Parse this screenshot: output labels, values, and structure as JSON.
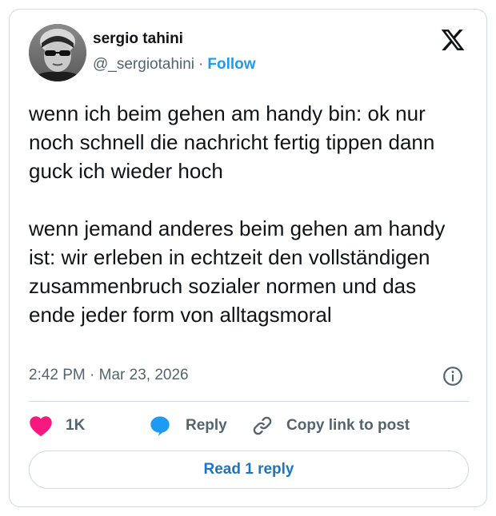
{
  "author": {
    "name": "sergio tahini",
    "handle": "@_sergiotahini",
    "separator": "·",
    "follow_label": "Follow"
  },
  "tweet": {
    "text": "wenn ich beim gehen am handy bin: ok nur noch schnell die nachricht fertig tippen dann guck ich wieder hoch\n\nwenn jemand anderes beim gehen am handy ist: wir erleben in echtzeit den vollständigen zusammenbruch sozialer normen und das ende jeder form von alltagsmoral",
    "timestamp": "2:42 PM · Mar 23, 2026"
  },
  "actions": {
    "like_count": "1K",
    "reply_label": "Reply",
    "copy_label": "Copy link to post"
  },
  "read_reply_label": "Read 1 reply",
  "icons": {
    "logo": "x-logo-icon",
    "info": "info-icon",
    "like": "heart-icon",
    "reply": "speech-bubble-icon",
    "copy": "link-icon"
  },
  "colors": {
    "accent": "#1d9bf0",
    "like": "#f91880",
    "muted": "#536471",
    "border": "#cfd9de"
  }
}
